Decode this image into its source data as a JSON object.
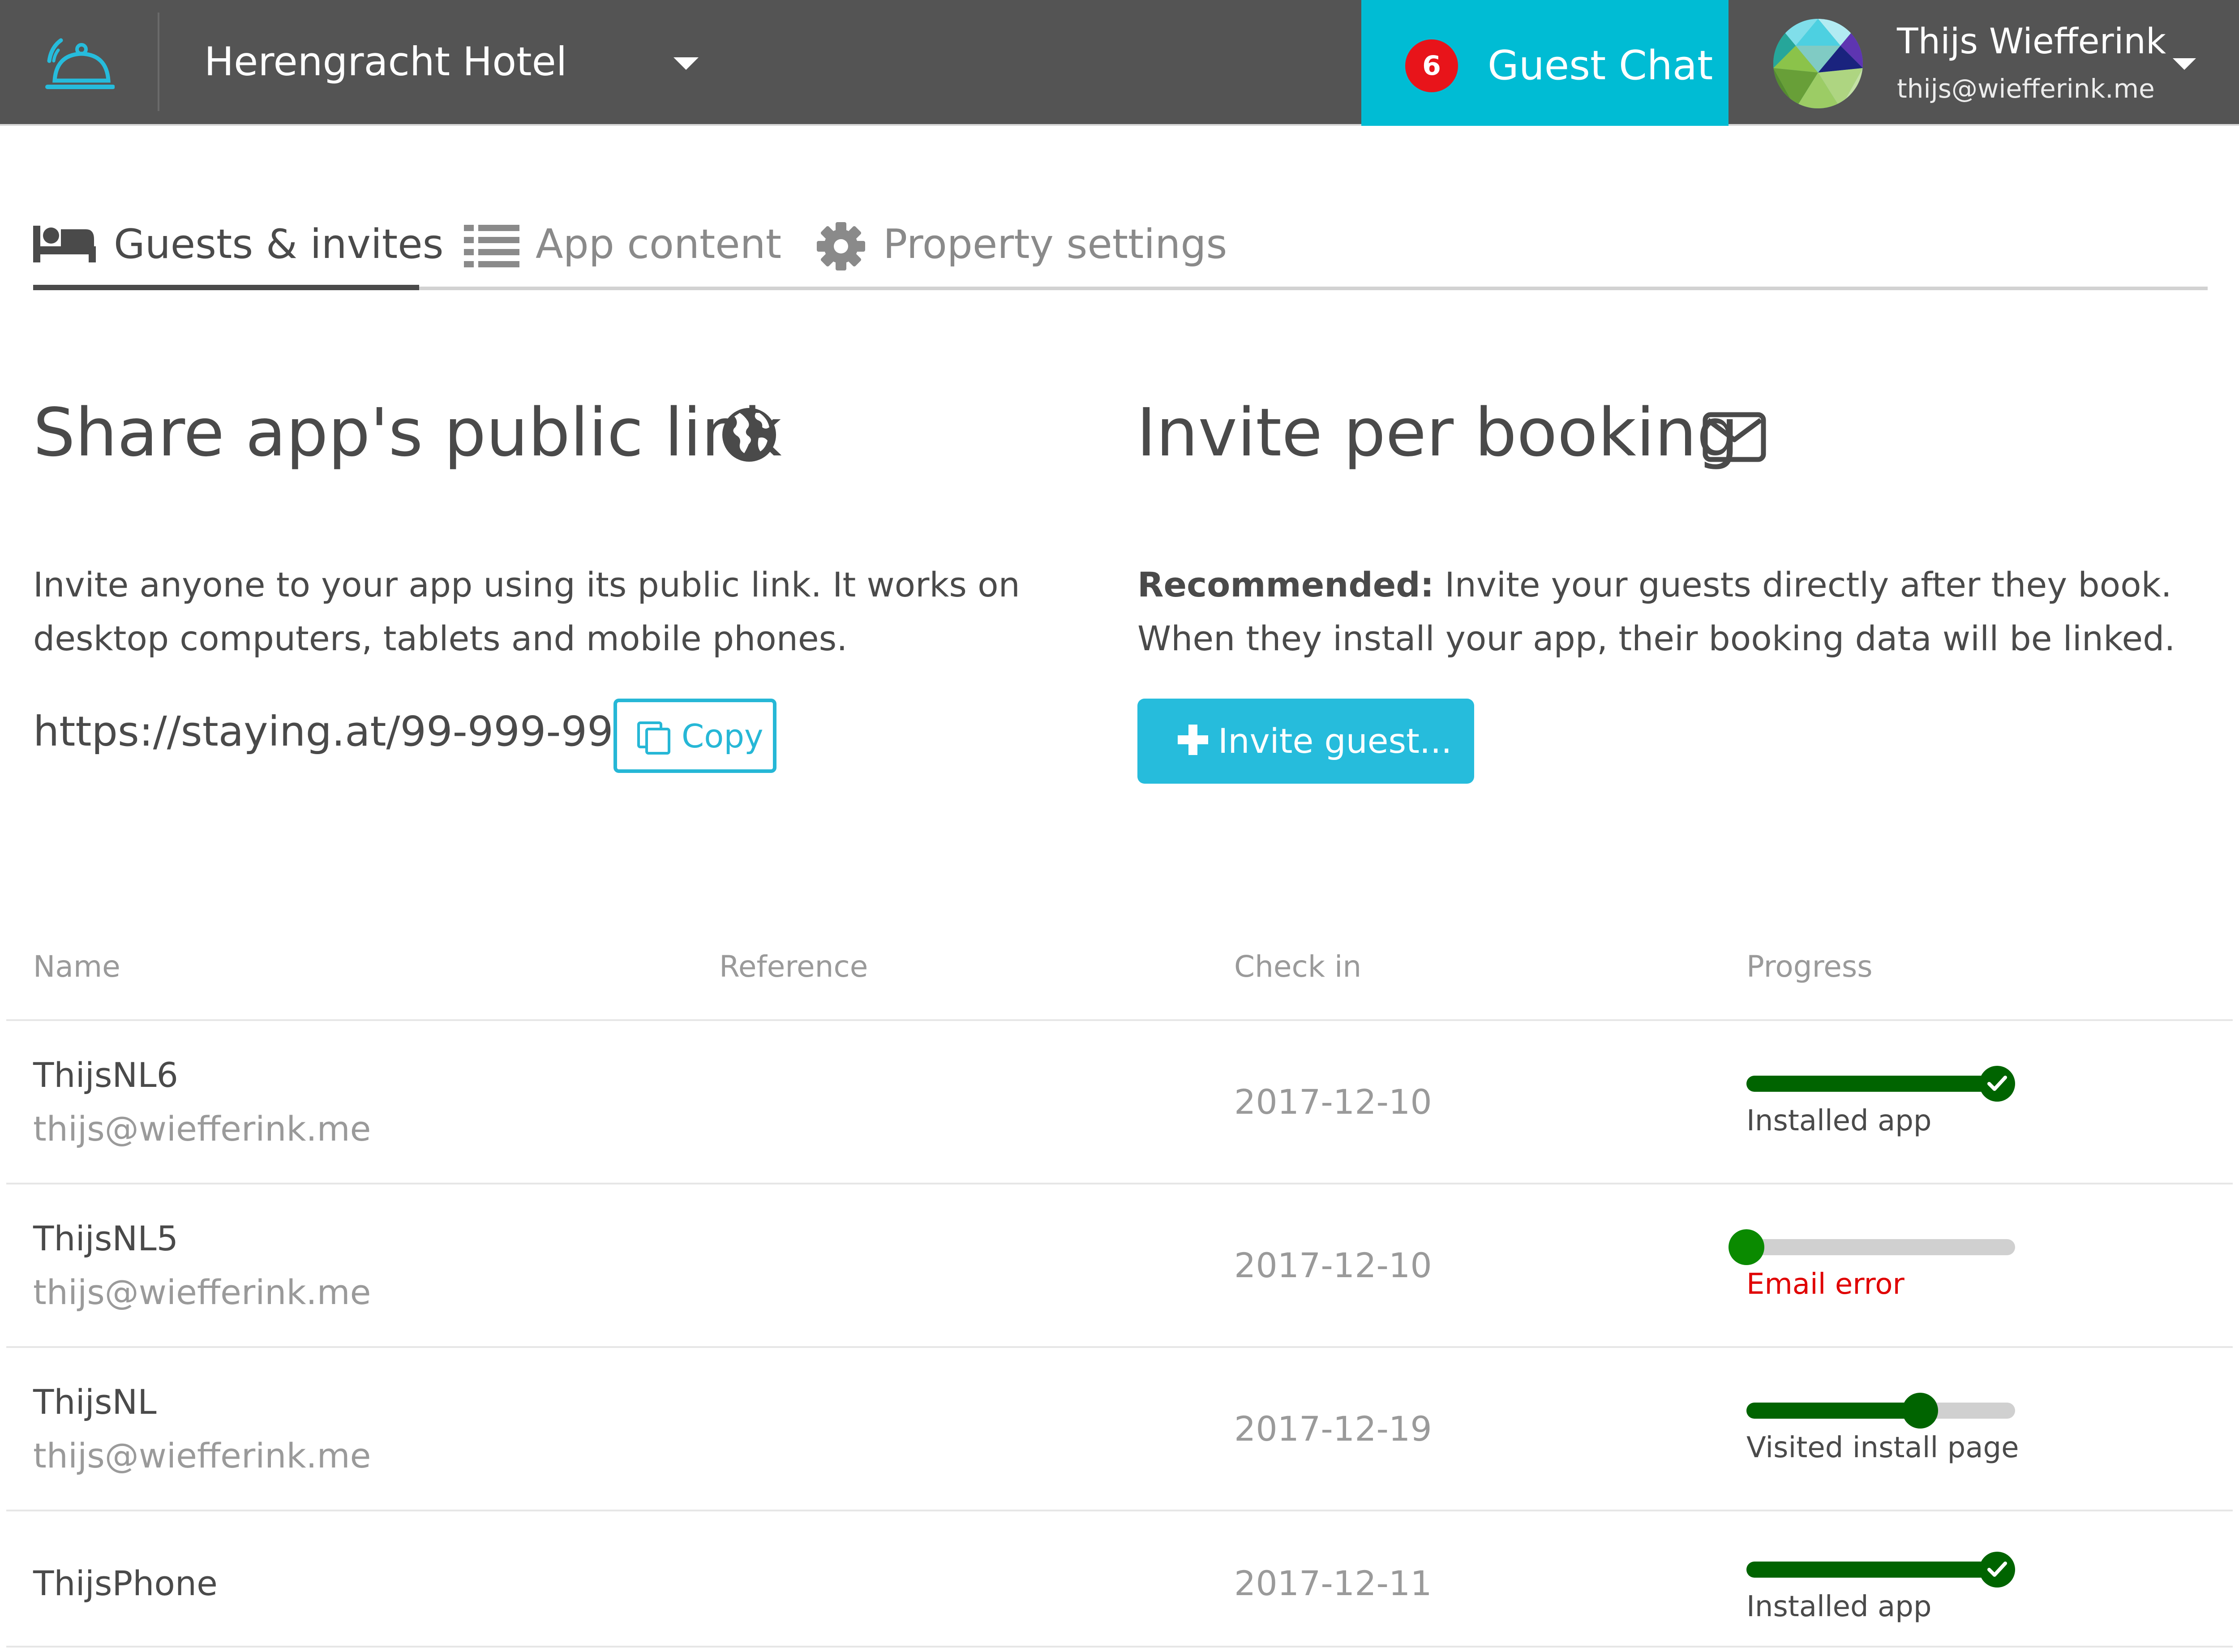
{
  "topbar": {
    "hotel_name": "Herengracht Hotel",
    "chat": {
      "badge_count": "6",
      "label": "Guest Chat"
    },
    "user": {
      "name": "Thijs Wiefferink",
      "email": "thijs@wiefferink.me"
    }
  },
  "tabs": [
    {
      "label": "Guests & invites",
      "icon": "bed-icon",
      "active": true
    },
    {
      "label": "App content",
      "icon": "list-icon",
      "active": false
    },
    {
      "label": "Property settings",
      "icon": "gear-icon",
      "active": false
    }
  ],
  "share": {
    "heading": "Share app's public link",
    "description": "Invite anyone to your app using its public link. It works on desktop computers, tablets and mobile phones.",
    "link": "https://staying.at/99-999-99",
    "copy_label": "Copy"
  },
  "invite": {
    "heading": "Invite per booking",
    "recommended_label": "Recommended:",
    "description": " Invite your guests directly after they book. When they install your app, their booking data will be linked.",
    "button_label": "Invite guest..."
  },
  "table": {
    "headers": [
      "Name",
      "Reference",
      "Check in",
      "Progress"
    ],
    "rows": [
      {
        "name": "ThijsNL6",
        "email": "thijs@wiefferink.me",
        "reference": "",
        "check_in": "2017-12-10",
        "progress": 1.0,
        "status": "Installed app",
        "status_type": "complete"
      },
      {
        "name": "ThijsNL5",
        "email": "thijs@wiefferink.me",
        "reference": "",
        "check_in": "2017-12-10",
        "progress": 0.0,
        "status": "Email error",
        "status_type": "error"
      },
      {
        "name": "ThijsNL",
        "email": "thijs@wiefferink.me",
        "reference": "",
        "check_in": "2017-12-19",
        "progress": 0.67,
        "status": "Visited install page",
        "status_type": "partial"
      },
      {
        "name": "ThijsPhone",
        "email": "",
        "reference": "",
        "check_in": "2017-12-11",
        "progress": 1.0,
        "status": "Installed app",
        "status_type": "complete"
      }
    ]
  },
  "colors": {
    "topbar": "#545454",
    "accent": "#00bcd4",
    "progress_done": "#006400",
    "error": "#e00000"
  }
}
